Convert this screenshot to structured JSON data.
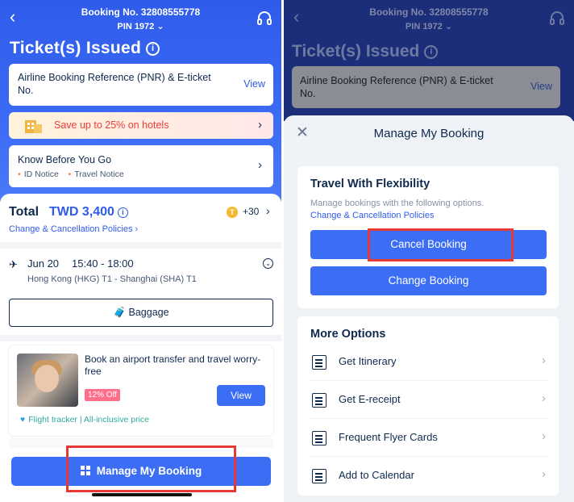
{
  "left": {
    "booking_no": "Booking No.  32808555778",
    "pin": "PIN 1972",
    "title": "Ticket(s) Issued",
    "pnr_card": {
      "text": "Airline Booking Reference (PNR) & E-ticket No.",
      "view": "View"
    },
    "promo": {
      "text": "Save up to 25% on hotels"
    },
    "know_before": {
      "title": "Know Before You Go",
      "id_notice": "ID Notice",
      "travel_notice": "Travel Notice"
    },
    "total": {
      "label": "Total",
      "value": "TWD 3,400",
      "coins": "+30",
      "policy": "Change & Cancellation Policies"
    },
    "flight": {
      "date": "Jun 20",
      "time": "15:40 - 18:00",
      "route": "Hong Kong (HKG) T1 - Shanghai (SHA) T1"
    },
    "baggage": "Baggage",
    "transfer": {
      "text": "Book an airport transfer and travel worry-free",
      "badge": "12% Off",
      "view": "View",
      "tracker": "Flight tracker | All-inclusive price"
    },
    "manage_button": "Manage My Booking"
  },
  "right": {
    "booking_no": "Booking No.  32808555778",
    "pin": "PIN 1972",
    "title": "Ticket(s) Issued",
    "pnr_card": {
      "text": "Airline Booking Reference (PNR) & E-ticket No.",
      "view": "View"
    },
    "modal": {
      "title": "Manage My Booking",
      "flex": {
        "title": "Travel With Flexibility",
        "subtitle": "Manage bookings with the following options.",
        "link": "Change & Cancellation Policies",
        "cancel": "Cancel Booking",
        "change": "Change Booking"
      },
      "more": {
        "title": "More Options",
        "items": [
          {
            "label": "Get Itinerary",
            "icon": "itinerary-icon"
          },
          {
            "label": "Get E-receipt",
            "icon": "receipt-icon"
          },
          {
            "label": "Frequent Flyer Cards",
            "icon": "card-icon"
          },
          {
            "label": "Add to Calendar",
            "icon": "calendar-icon"
          }
        ]
      }
    }
  },
  "colors": {
    "brand_blue": "#3c6df5",
    "highlight_red": "#e53935",
    "promo_red": "#ee3b3b"
  }
}
